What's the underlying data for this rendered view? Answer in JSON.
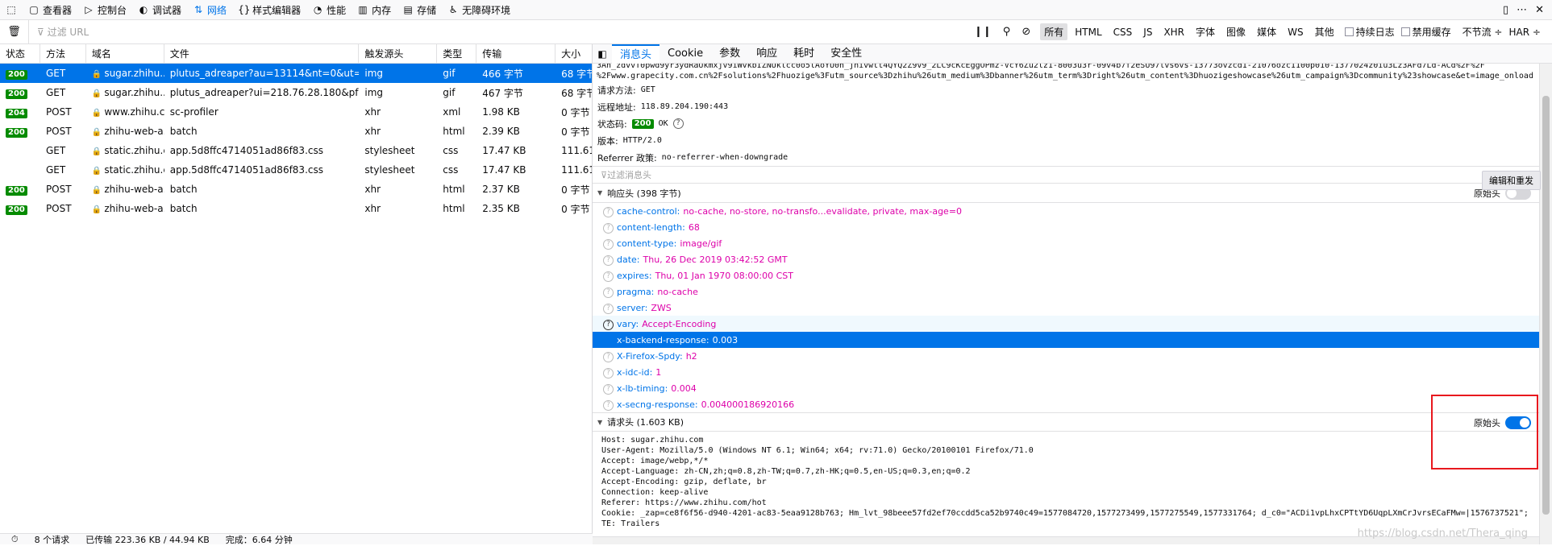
{
  "toolbar": {
    "tabs": [
      {
        "label": "查看器",
        "icon": "inspector-icon"
      },
      {
        "label": "控制台",
        "icon": "console-icon"
      },
      {
        "label": "调试器",
        "icon": "debugger-icon"
      },
      {
        "label": "网络",
        "icon": "network-icon"
      },
      {
        "label": "样式编辑器",
        "icon": "style-editor-icon"
      },
      {
        "label": "性能",
        "icon": "performance-icon"
      },
      {
        "label": "内存",
        "icon": "memory-icon"
      },
      {
        "label": "存储",
        "icon": "storage-icon"
      },
      {
        "label": "无障碍环境",
        "icon": "accessibility-icon"
      }
    ],
    "active_tab": "网络"
  },
  "filterbar": {
    "placeholder": "过滤 URL",
    "types": [
      "所有",
      "HTML",
      "CSS",
      "JS",
      "XHR",
      "字体",
      "图像",
      "媒体",
      "WS",
      "其他"
    ],
    "selected_type": "所有",
    "persist_log": "持续日志",
    "disable_cache": "禁用缓存",
    "throttle": "不节流 ÷",
    "har": "HAR ÷"
  },
  "request_table": {
    "columns": [
      "状态",
      "方法",
      "域名",
      "文件",
      "触发源头",
      "类型",
      "传输",
      "大小"
    ],
    "rows": [
      {
        "status": "200",
        "method": "GET",
        "domain": "sugar.zhihu....",
        "file": "plutus_adreaper?au=13114&nt=0&ut=e3b...",
        "cause": "img",
        "type": "gif",
        "transferred": "466 字节",
        "size": "68 字节",
        "selected": true
      },
      {
        "status": "200",
        "method": "GET",
        "domain": "sugar.zhihu....",
        "file": "plutus_adreaper?ui=218.76.28.180&pf=4&...",
        "cause": "img",
        "type": "gif",
        "transferred": "467 字节",
        "size": "68 字节",
        "selected": false
      },
      {
        "status": "204",
        "method": "POST",
        "domain": "www.zhihu.c...",
        "file": "sc-profiler",
        "cause": "xhr",
        "type": "xml",
        "transferred": "1.98 KB",
        "size": "0 字节",
        "selected": false
      },
      {
        "status": "200",
        "method": "POST",
        "domain": "zhihu-web-a...",
        "file": "batch",
        "cause": "xhr",
        "type": "html",
        "transferred": "2.39 KB",
        "size": "0 字节",
        "selected": false
      },
      {
        "status": "",
        "method": "GET",
        "domain": "static.zhihu.c...",
        "file": "app.5d8ffc4714051ad86f83.css",
        "cause": "stylesheet",
        "type": "css",
        "transferred": "17.47 KB",
        "size": "111.61...",
        "selected": false
      },
      {
        "status": "",
        "method": "GET",
        "domain": "static.zhihu.c...",
        "file": "app.5d8ffc4714051ad86f83.css",
        "cause": "stylesheet",
        "type": "css",
        "transferred": "17.47 KB",
        "size": "111.61...",
        "selected": false
      },
      {
        "status": "200",
        "method": "POST",
        "domain": "zhihu-web-a...",
        "file": "batch",
        "cause": "xhr",
        "type": "html",
        "transferred": "2.37 KB",
        "size": "0 字节",
        "selected": false
      },
      {
        "status": "200",
        "method": "POST",
        "domain": "zhihu-web-a...",
        "file": "batch",
        "cause": "xhr",
        "type": "html",
        "transferred": "2.35 KB",
        "size": "0 字节",
        "selected": false
      }
    ]
  },
  "statusbar": {
    "requests": "8 个请求",
    "transferred": "已传输 223.36 KB / 44.94 KB",
    "finished": "完成：6.64 分钟"
  },
  "detail": {
    "tabs": [
      "消息头",
      "Cookie",
      "参数",
      "响应",
      "耗时",
      "安全性"
    ],
    "active_tab": "消息头",
    "url_line1": "3Ah_zdvvT0pwd9yr3ydRaUkmxjv9iWvkbIZNUklcc0o5lAoYU0n_jnivwtt4QYQ2Z9v9_2LC9cKcEggOPmz-VcY6Zu2lz1-8003u3r-09v4b7f2eSU97lvs6vs-13773ovzcd1-21076ozc1100p010-1377024z0iu3Lz3AFd7Ld-ACd%2F%2F",
    "url_line2": "%2Fwww.grapecity.com.cn%2Fsolutions%2Fhuozige%3Futm_source%3Dzhihu%26utm_medium%3Dbanner%26utm_term%3Dright%26utm_content%3Dhuozigeshowcase%26utm_campaign%3Dcommunity%23showcase&et=image_onload",
    "summary": {
      "method_label": "请求方法:",
      "method_value": "GET",
      "remote_label": "远程地址:",
      "remote_value": "118.89.204.190:443",
      "status_label": "状态码:",
      "status_code": "200",
      "status_text": "OK",
      "version_label": "版本:",
      "version_value": "HTTP/2.0",
      "referrer_label": "Referrer 政策:",
      "referrer_value": "no-referrer-when-downgrade"
    },
    "resend_button": "编辑和重发",
    "filter_headers_placeholder": "过滤消息头",
    "response_headers": {
      "title": "响应头 (398 字节)",
      "raw_label": "原始头",
      "raw_on": false,
      "items": [
        {
          "name": "cache-control:",
          "value": "no-cache, no-store, no-transfo...evalidate, private, max-age=0"
        },
        {
          "name": "content-length:",
          "value": "68"
        },
        {
          "name": "content-type:",
          "value": "image/gif"
        },
        {
          "name": "date:",
          "value": "Thu, 26 Dec 2019 03:42:52 GMT"
        },
        {
          "name": "expires:",
          "value": "Thu, 01 Jan 1970 08:00:00 CST"
        },
        {
          "name": "pragma:",
          "value": "no-cache"
        },
        {
          "name": "server:",
          "value": "ZWS"
        },
        {
          "name": "vary:",
          "value": "Accept-Encoding",
          "hover": true
        },
        {
          "name": "x-backend-response:",
          "value": "0.003",
          "selected": true
        },
        {
          "name": "X-Firefox-Spdy:",
          "value": "h2"
        },
        {
          "name": "x-idc-id:",
          "value": "1"
        },
        {
          "name": "x-lb-timing:",
          "value": "0.004"
        },
        {
          "name": "x-secng-response:",
          "value": "0.004000186920166"
        }
      ]
    },
    "request_headers": {
      "title": "请求头 (1.603 KB)",
      "raw_label": "原始头",
      "raw_on": true,
      "raw_lines": [
        "Host: sugar.zhihu.com",
        "User-Agent: Mozilla/5.0 (Windows NT 6.1; Win64; x64; rv:71.0) Gecko/20100101 Firefox/71.0",
        "Accept: image/webp,*/*",
        "Accept-Language: zh-CN,zh;q=0.8,zh-TW;q=0.7,zh-HK;q=0.5,en-US;q=0.3,en;q=0.2",
        "Accept-Encoding: gzip, deflate, br",
        "Connection: keep-alive",
        "Referer: https://www.zhihu.com/hot",
        "Cookie: _zap=ce8f6f56-d940-4201-ac83-5eaa9128b763; Hm_lvt_98beee57fd2ef70ccdd5ca52b9740c49=1577084720,1577273499,1577275549,1577331764; d_c0=\"ACDi1vpLhxCPTtYD6UqpLXmCrJvrsECaFMw=|1576737521\";",
        "TE: Trailers"
      ]
    }
  },
  "watermark": "https://blog.csdn.net/Thera_qing"
}
